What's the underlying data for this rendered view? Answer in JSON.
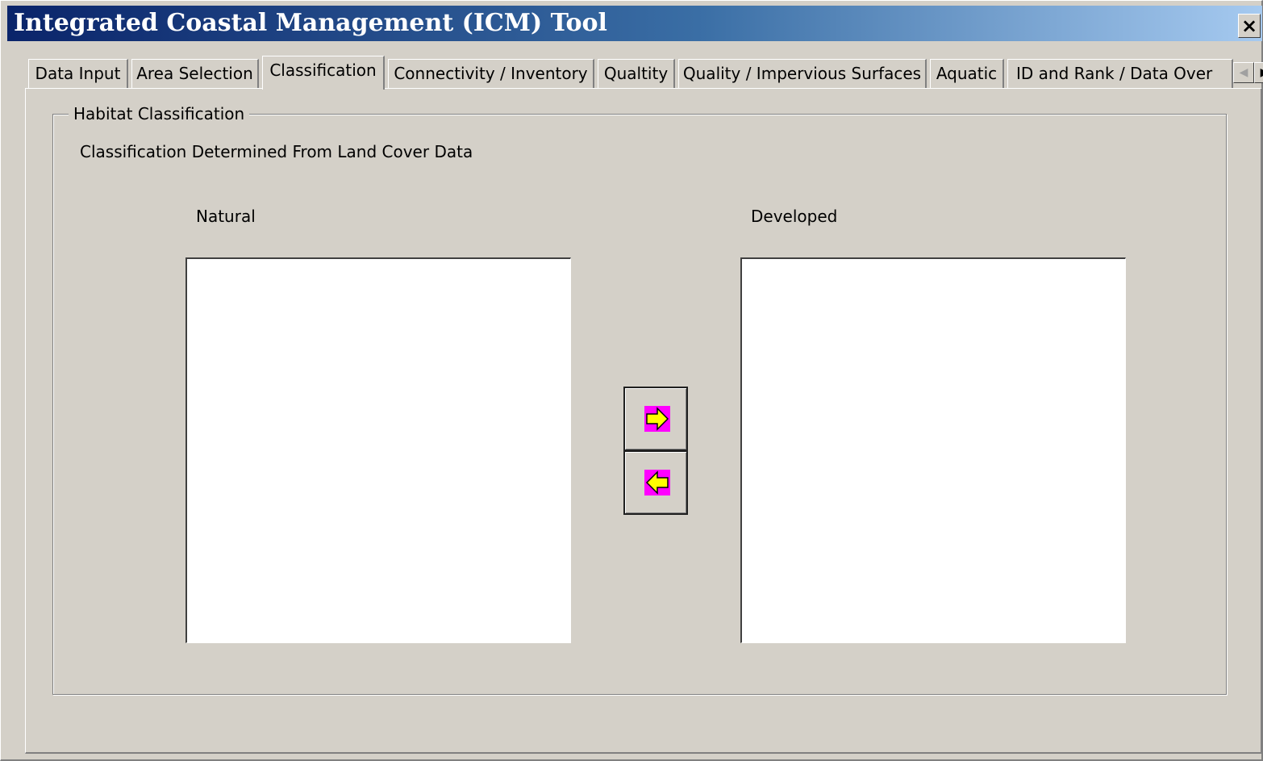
{
  "window": {
    "title": "Integrated Coastal Management (ICM) Tool",
    "close_label": "×"
  },
  "tabs": [
    {
      "label": "Data Input",
      "active": false
    },
    {
      "label": "Area Selection",
      "active": false
    },
    {
      "label": "Classification",
      "active": true
    },
    {
      "label": "Connectivity / Inventory",
      "active": false
    },
    {
      "label": "Qualtity",
      "active": false
    },
    {
      "label": "Quality / Impervious Surfaces",
      "active": false
    },
    {
      "label": "Aquatic",
      "active": false
    },
    {
      "label": "ID and Rank / Data Over",
      "active": false
    }
  ],
  "tab_scroll": {
    "left_icon": "scroll-left-icon",
    "right_icon": "scroll-right-icon"
  },
  "group": {
    "title": "Habitat Classification",
    "description": "Classification Determined From Land Cover Data"
  },
  "lists": {
    "natural": {
      "label": "Natural",
      "items": []
    },
    "developed": {
      "label": "Developed",
      "items": []
    }
  },
  "buttons": {
    "move_right_icon": "arrow-right-icon",
    "move_left_icon": "arrow-left-icon"
  },
  "colors": {
    "face": "#d4d0c8",
    "titlebar_start": "#0a246a",
    "titlebar_end": "#a6caf0",
    "arrow_fill": "#ffff00",
    "arrow_bg": "#ff00ff"
  }
}
